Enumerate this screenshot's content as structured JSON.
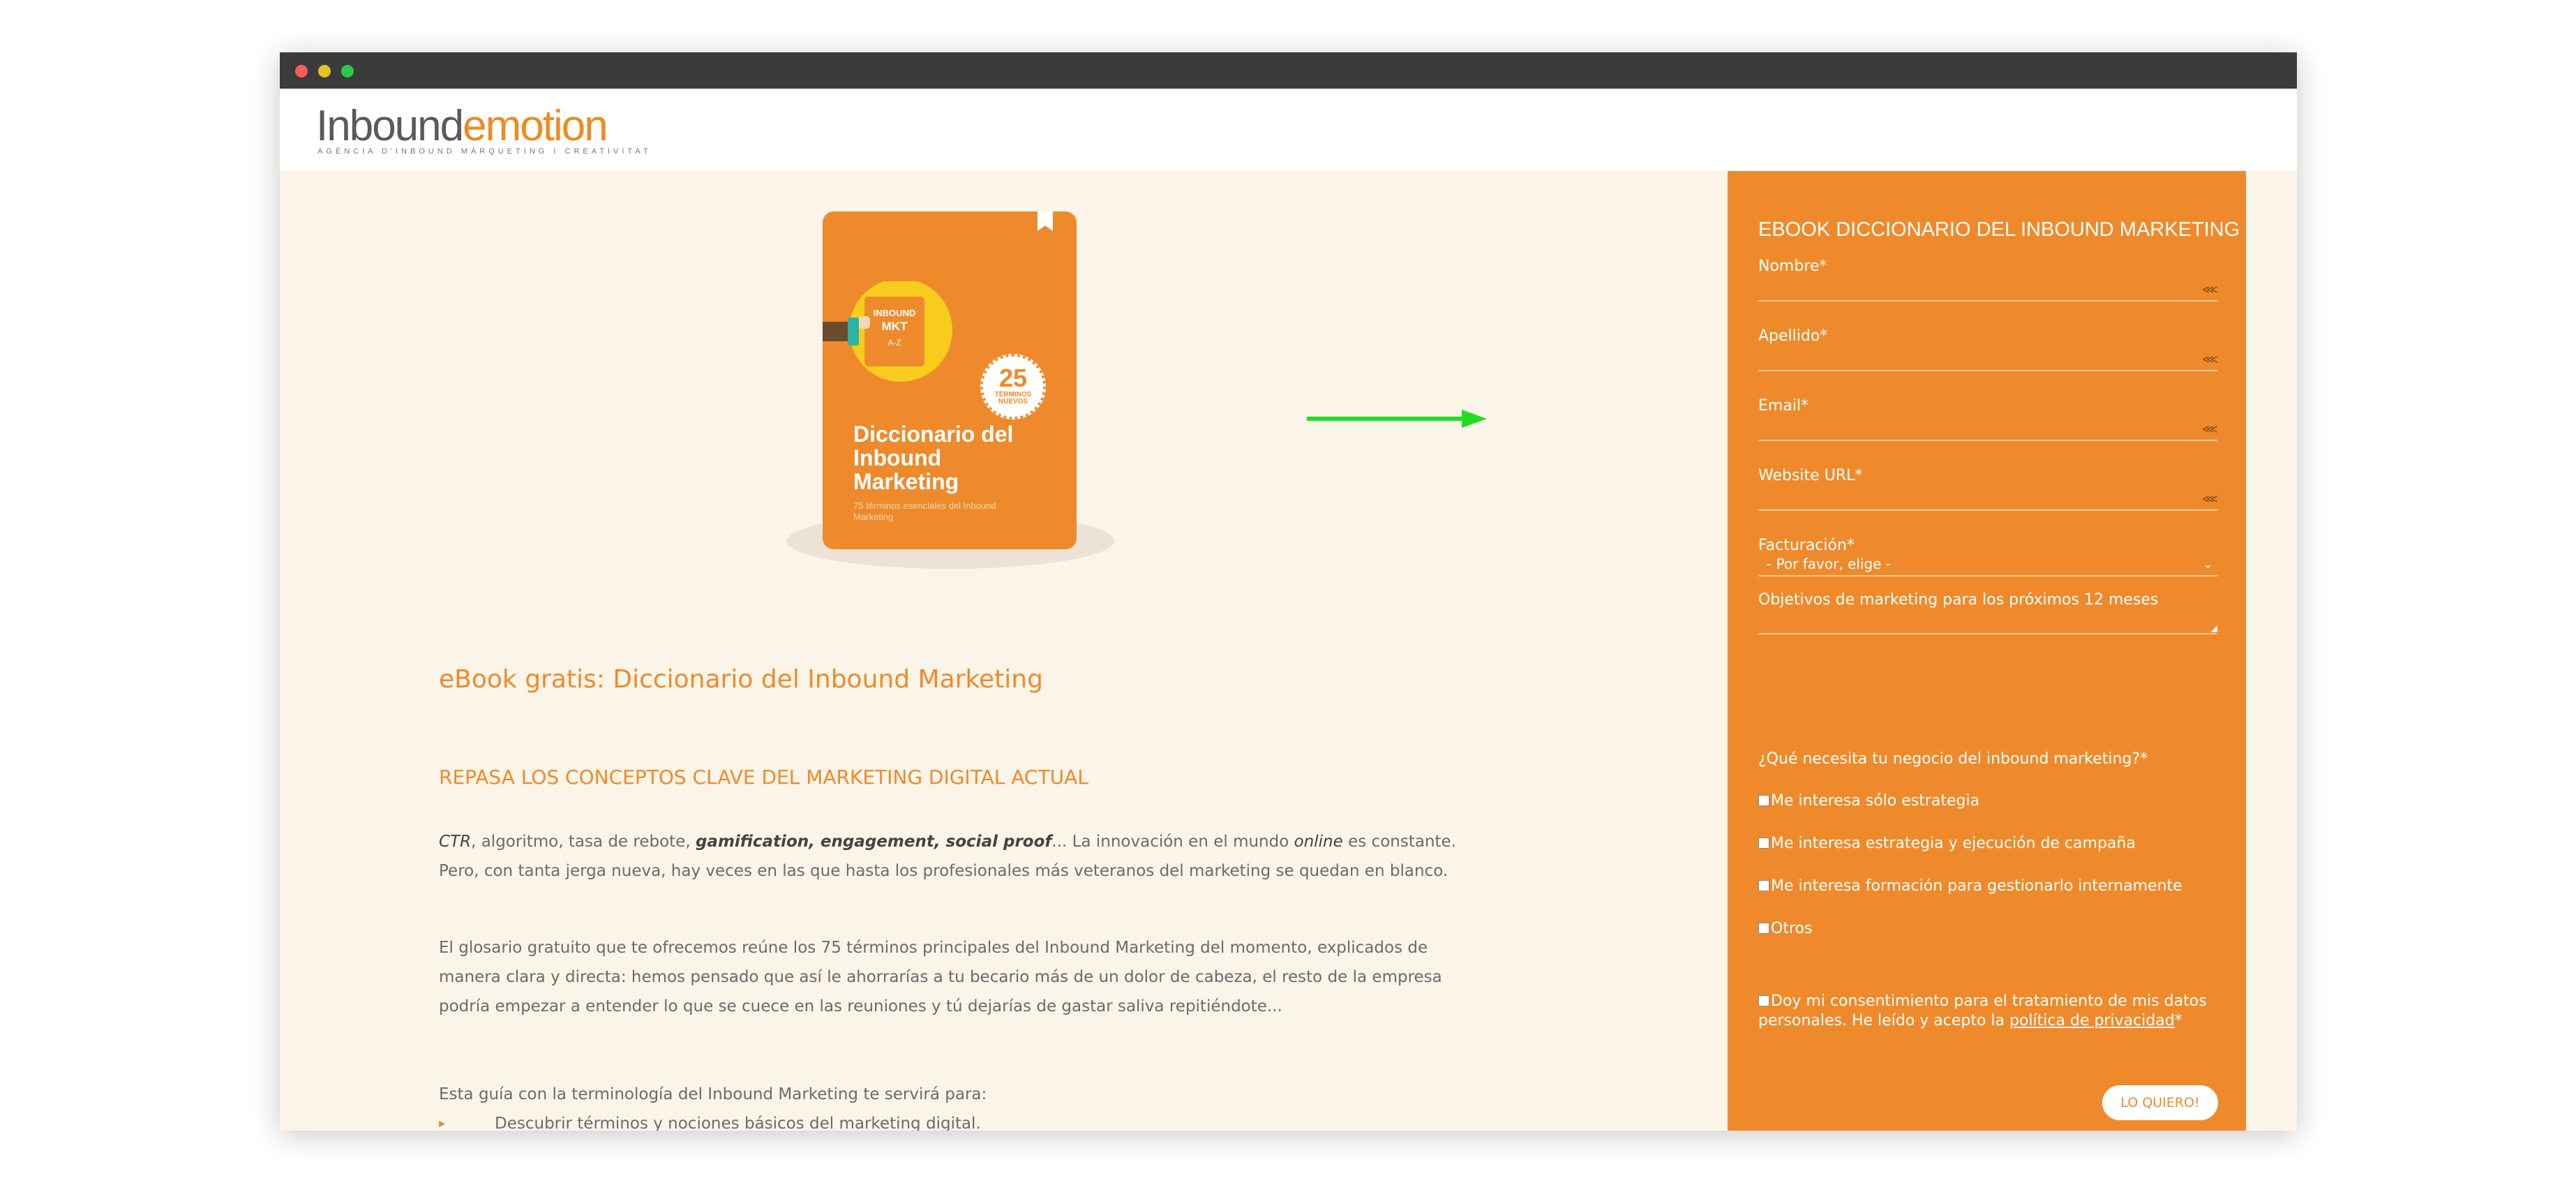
{
  "window": {
    "controls": [
      "close",
      "minimize",
      "maximize"
    ]
  },
  "header": {
    "logo_part1": "Inbound",
    "logo_part2": "emotion",
    "logo_tagline": "AGÈNCIA D'INBOUND MÀRQUETING I CREATIVITAT"
  },
  "book": {
    "badge_number": "25",
    "badge_text": "TÉRMINOS NUEVOS",
    "notebook_line1": "INBOUND",
    "notebook_line2": "MKT",
    "notebook_line3": "A-Z",
    "title": "Diccionario del Inbound Marketing",
    "subtitle": "75 términos esenciales del Inbound Marketing"
  },
  "main": {
    "title": "eBook gratis: Diccionario del Inbound Marketing",
    "section_heading": "REPASA LOS CONCEPTOS CLAVE DEL MARKETING DIGITAL ACTUAL",
    "p1": {
      "t1": "CTR",
      "t2": ", algoritmo, tasa de rebote, ",
      "t3": "gamification, engagement, social proof",
      "t4": "... La innovación en el mundo ",
      "t5": "online",
      "t6": " es constante. Pero, con tanta jerga nueva, hay veces en las que hasta los profesionales más veteranos del marketing se quedan en blanco."
    },
    "p2": "El glosario gratuito que te ofrecemos reúne los 75 términos principales del Inbound Marketing del momento, explicados de manera clara y directa: hemos pensado que así le ahorrarías a tu becario más de un dolor de cabeza, el resto de la empresa podría empezar a entender lo que se cuece en las reuniones y tú dejarías de gastar saliva repitiéndote...",
    "p3": "Esta guía con la terminología del Inbound Marketing te servirá para:",
    "bullets": [
      "Descubrir términos y nociones básicos del marketing digital."
    ]
  },
  "form": {
    "title": "EBOOK DICCIONARIO DEL INBOUND MARKETING",
    "fields": [
      {
        "label": "Nombre*"
      },
      {
        "label": "Apellido*"
      },
      {
        "label": "Email*"
      },
      {
        "label": "Website URL*"
      }
    ],
    "billing_label": "Facturación*",
    "billing_value": "- Por favor, elige -",
    "objectives_label": "Objetivos de marketing para los próximos 12 meses",
    "question": "¿Qué necesita tu negocio del inbound marketing?*",
    "options": [
      "Me interesa sólo estrategia",
      "Me interesa estrategia y ejecución de campaña",
      "Me interesa formación para gestionarlo internamente",
      "Otros"
    ],
    "consent_text": "Doy mi consentimiento para el tratamiento de mis datos personales. He leído y acepto la ",
    "consent_link": "política de privacidad",
    "consent_suffix": "*",
    "submit_label": "LO QUIERO!"
  },
  "colors": {
    "accent": "#ee8a2b",
    "page_bg": "#fbf4e8",
    "arrow": "#22dd22",
    "titlebar": "#3b3b3b"
  }
}
